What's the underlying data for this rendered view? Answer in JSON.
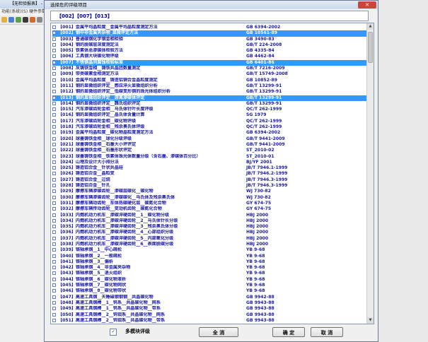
{
  "background_app": {
    "title": "【无检验报表】 - 金相",
    "menu": "功能(系统)(S)  硬件参数"
  },
  "dialog": {
    "title": "选择危的评级项目",
    "close_label": "✕"
  },
  "selected_codes": "【002】【007】【013】",
  "items": [
    {
      "code": "【001】",
      "name": "金属平均晶粒度__金属平均晶粒度测定方法",
      "std": "GB 6394-2002",
      "selected": false
    },
    {
      "code": "【002】",
      "name": "钢中非金属夹杂物_显微评定方法",
      "std": "GB 10561-89",
      "selected": true
    },
    {
      "code": "【003】",
      "name": "普通碳钢化学钢金相检验",
      "std": "GB 3490-83",
      "selected": false
    },
    {
      "code": "【004】",
      "name": "钢的脱碳层深度测定法",
      "std": "GB/T 224-2008",
      "selected": false
    },
    {
      "code": "【005】",
      "name": "铁素体总渗碳体检验方法",
      "std": "GB 4335-84",
      "selected": false
    },
    {
      "code": "【006】",
      "name": "工具钢大块碳化物评级",
      "std": "GB 4462-84",
      "selected": false
    },
    {
      "code": "【007】",
      "name": "不锈钢晶间腐蚀检验标准",
      "std": "GB 6401-86",
      "selected": true
    },
    {
      "code": "【008】",
      "name": "灰铸铁金相__铸铁共晶团数量测定",
      "std": "GB/T 7216-2009",
      "selected": false
    },
    {
      "code": "【009】",
      "name": "带类碳素金相测定方法",
      "std": "GB/T 15749-2008",
      "selected": false
    },
    {
      "code": "【010】",
      "name": "金属平均晶粒度__铸造铝铜合金晶粒度测定",
      "std": "GB 10852-89",
      "selected": false
    },
    {
      "code": "【011】",
      "name": "钢的显微组织评定__感应淬火显微组织分析",
      "std": "GB/T 13299-91",
      "selected": false
    },
    {
      "code": "【012】",
      "name": "钢的显微组织评定__低碳变形钢的珠光体组织分析",
      "std": "GB/T 13299-91",
      "selected": false
    },
    {
      "code": "【013】",
      "name": "钢的显微组织评定__游离渗碳体评定",
      "std": "GB/T 13299-91",
      "selected": true
    },
    {
      "code": "【014】",
      "name": "钢的显微组织评定__魏氏组织评定",
      "std": "GB/T 13299-91",
      "selected": false
    },
    {
      "code": "【015】",
      "name": "汽车渗碳齿轮金相__马氏体针叶长度评级",
      "std": "QC/T 262-1999",
      "selected": false
    },
    {
      "code": "【016】",
      "name": "钢的显微组织评定__晶氏体含量计算",
      "std": "SG 1979",
      "selected": false
    },
    {
      "code": "【017】",
      "name": "汽车渗碳齿轮金相__碳化物评级",
      "std": "QC/T 262-1999",
      "selected": false
    },
    {
      "code": "【018】",
      "name": "汽车渗碳齿轮金相__残余奥氏体评级",
      "std": "QC/T 262-1999",
      "selected": false
    },
    {
      "code": "【019】",
      "name": "金属平均晶粒度__碳化物晶粒度测定方法",
      "std": "GB 6394-2002",
      "selected": false
    },
    {
      "code": "【020】",
      "name": "球墨铸铁金相__球化分级评级",
      "std": "GB/T 9441-2009",
      "selected": false
    },
    {
      "code": "【021】",
      "name": "球墨铸铁金相__石墨大小评评定",
      "std": "GB/T 9441-2009",
      "selected": false
    },
    {
      "code": "【022】",
      "name": "球墨铸铁金相__石墨形状评定",
      "std": "ST_2010-02",
      "selected": false
    },
    {
      "code": "【023】",
      "name": "球墨铸铁金相__铁素体珠光体数量分级（含石墨、渗碳体百分比）",
      "std": "ST_2010-01",
      "selected": false
    },
    {
      "code": "【024】",
      "name": "山埋及设计大小排分法",
      "std": "BJ/YF 2001",
      "selected": false
    },
    {
      "code": "【025】",
      "name": "铸造铝合金__针状共晶硅",
      "std": "JB/T 7946.1-1999",
      "selected": false
    },
    {
      "code": "【026】",
      "name": "铸造铝合金__晶粒变",
      "std": "JB/T 7946.2-1999",
      "selected": false
    },
    {
      "code": "【027】",
      "name": "铸造铝合金__过烧",
      "std": "JB/T 7946.3-1999",
      "selected": false
    },
    {
      "code": "【028】",
      "name": "铸造铝合金__针孔",
      "std": "JB/T 7946.3-1999",
      "selected": false
    },
    {
      "code": "【029】",
      "name": "摩擦车辆渗碳齿轮__渗碳层碳化__碳化物",
      "std": "WJ 730-82",
      "selected": false
    },
    {
      "code": "【030】",
      "name": "摩擦车辆渗碳齿轮__渗碳碳化__马氏体及残余奥氏体",
      "std": "WJ 730-82",
      "selected": false
    },
    {
      "code": "【031】",
      "name": "摩擦车辆动齿轮__车体热碳硬化层__碳氮化合物",
      "std": "GY 674-75",
      "selected": false
    },
    {
      "code": "【032】",
      "name": "摩擦车辆传动齿轮__变动机齿轮__碳氮化合物",
      "std": "GY 674-75",
      "selected": false
    },
    {
      "code": "【033】",
      "name": "内燃机动力机车__渗碳淬硬齿轮__1__碳化物分级",
      "std": "HBJ 2000",
      "selected": false
    },
    {
      "code": "【034】",
      "name": "内燃机动力机车__渗碳淬硬齿轮__2__马氏体针长分级",
      "std": "HBJ 2000",
      "selected": false
    },
    {
      "code": "【035】",
      "name": "内燃机动力机车__渗碳淬硬齿轮__3__残余奥氏体分级",
      "std": "HBJ 2000",
      "selected": false
    },
    {
      "code": "【036】",
      "name": "内燃机动力机车__渗碳淬硬齿轮__4__心部组织分级",
      "std": "HBJ 2000",
      "selected": false
    },
    {
      "code": "【037】",
      "name": "内燃机动力机车__渗碳淬硬齿轮__5__内部氧化分级",
      "std": "HBJ 2000",
      "selected": false
    },
    {
      "code": "【038】",
      "name": "内燃机动力机车__渗碳淬硬齿轮__6__表面脱碳分级",
      "std": "HBJ 2000",
      "selected": false
    },
    {
      "code": "【039】",
      "name": "铬轴承钢__1__中心疏松",
      "std": "YB 9-68",
      "selected": false
    },
    {
      "code": "【040】",
      "name": "铬轴承钢__2__一般疏松",
      "std": "YB 9-68",
      "selected": false
    },
    {
      "code": "【041】",
      "name": "铬轴承钢__3__偏析",
      "std": "YB 9-68",
      "selected": false
    },
    {
      "code": "【042】",
      "name": "铬轴承钢__4__非金属夹杂物",
      "std": "YB 9-68",
      "selected": false
    },
    {
      "code": "【043】",
      "name": "铬轴承钢__5__退火组织",
      "std": "YB 9-68",
      "selected": false
    },
    {
      "code": "【044】",
      "name": "铬轴承钢__6__碳化物液析",
      "std": "YB 9-68",
      "selected": false
    },
    {
      "code": "【045】",
      "name": "铬轴承钢__7__碳化物网状",
      "std": "YB 9-68",
      "selected": false
    },
    {
      "code": "【046】",
      "name": "铬轴承钢__8__碳化物带状",
      "std": "YB 9-68",
      "selected": false
    },
    {
      "code": "【047】",
      "name": "高速工具钢__天睡磁钢钢钢__共晶碳化物",
      "std": "GB 9942-88",
      "selected": false
    },
    {
      "code": "【048】",
      "name": "高速工具钢棒__1__钨系__共晶碳化物__网系",
      "std": "GB 9943-88",
      "selected": false
    },
    {
      "code": "【049】",
      "name": "高速工具钢棒__1__钨系__共晶碳化物__带系",
      "std": "GB 9943-88",
      "selected": false
    },
    {
      "code": "【050】",
      "name": "高速工具钢棒__2__钨钼系__共晶碳化物__网系",
      "std": "GB 9943-88",
      "selected": false
    },
    {
      "code": "【051】",
      "name": "高速工具钢棒__2__钨钼系__共晶碳化物__带系",
      "std": "GB 9943-88",
      "selected": false
    },
    {
      "code": "【052】",
      "name": "变形铝及铝合金制品显微组织检验_组织检验",
      "std": "GB/T 3246.1-2000",
      "selected": false
    },
    {
      "code": "【053】",
      "name": "变形铝及铝合金制品低倍组织检验",
      "std": "GB/T 3246.2-2000",
      "selected": false
    },
    {
      "code": "【054】",
      "name": "钢材断口检验",
      "std": "GB 1814-79",
      "selected": false
    },
    {
      "code": "【055】",
      "name": "汽车渗碳齿轮金相__贫氏体组织评级",
      "std": "QC/T 262-1999",
      "selected": false
    }
  ],
  "bottom": {
    "multi_select_checked": "✓",
    "multi_select_label": "多模块评级",
    "select_all_label": "全 消",
    "ok_label": "确 定",
    "cancel_label": "取 消"
  },
  "colors": {
    "text": "#1a1aa6",
    "selection": "#3399ff",
    "close": "#c9463d"
  }
}
